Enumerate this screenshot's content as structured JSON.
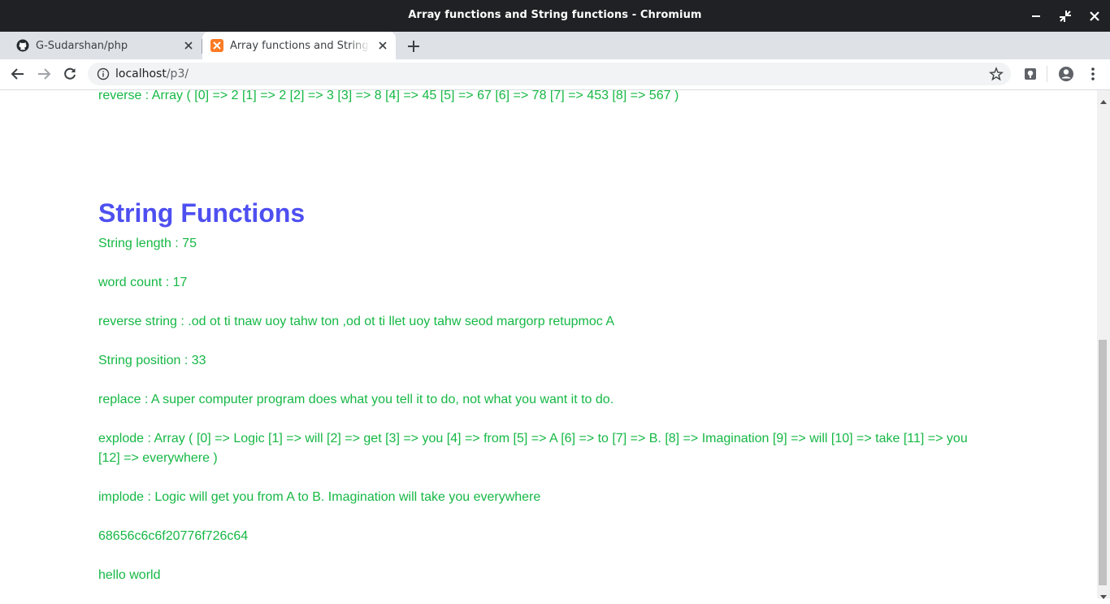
{
  "window": {
    "title": "Array functions and String functions - Chromium"
  },
  "tabs": [
    {
      "label": "G-Sudarshan/php",
      "icon": "github-icon",
      "active": false
    },
    {
      "label": "Array functions and String functions",
      "icon": "xampp-icon",
      "active": true
    }
  ],
  "toolbar": {
    "url_host": "localhost",
    "url_path": "/p3/"
  },
  "page": {
    "reverse_line": "reverse : Array ( [0] => 2 [1] => 2 [2] => 3 [3] => 8 [4] => 45 [5] => 67 [6] => 78 [7] => 453 [8] => 567 )",
    "section_heading": "String Functions",
    "lines": {
      "length": "String length : 75",
      "word_count": "word count : 17",
      "reverse_string": "reverse string : .od ot ti tnaw uoy tahw ton ,od ot ti llet uoy tahw seod margorp retupmoc A",
      "position": "String position : 33",
      "replace": "replace : A super computer program does what you tell it to do, not what you want it to do.",
      "explode": "explode : Array ( [0] => Logic [1] => will [2] => get [3] => you [4] => from [5] => A [6] => to [7] => B. [8] => Imagination [9] => will [10] => take [11] => you [12] => everywhere )",
      "implode": "implode : Logic will get you from A to B. Imagination will take you everywhere",
      "hex": "68656c6c6f20776f726c64",
      "decoded": "hello world"
    }
  },
  "colors": {
    "text": "#16b845",
    "heading": "#4e4ff0",
    "titlebar": "#202124",
    "tabstrip": "#dee1e6"
  }
}
